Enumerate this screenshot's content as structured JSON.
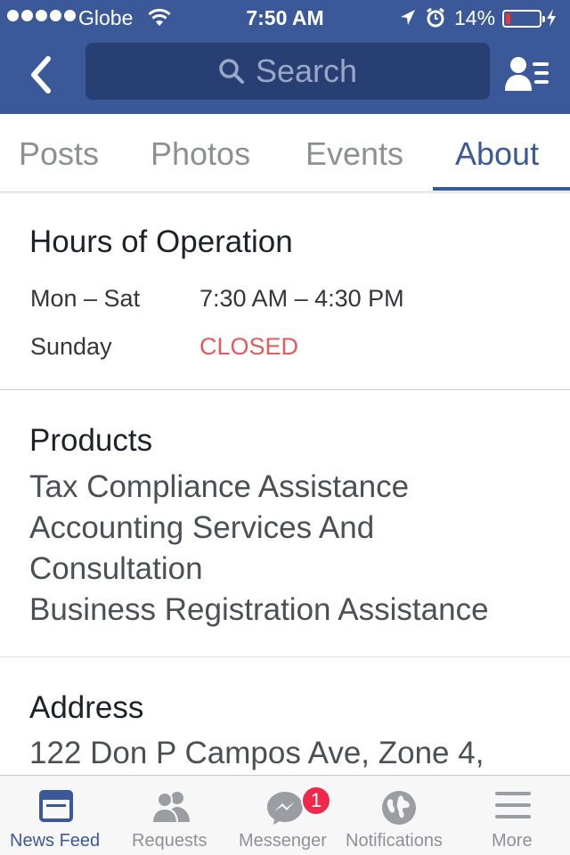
{
  "status_bar": {
    "carrier": "Globe",
    "time": "7:50 AM",
    "battery_percent": "14%",
    "battery_level": 0.14,
    "signal_bars": 5
  },
  "header": {
    "back_icon": "chevron-left-icon",
    "search_placeholder": "Search",
    "friends_icon": "friend-list-icon"
  },
  "tabs": [
    {
      "label": "Posts",
      "active": false
    },
    {
      "label": "Photos",
      "active": false
    },
    {
      "label": "Events",
      "active": false
    },
    {
      "label": "About",
      "active": true
    }
  ],
  "hours": {
    "title": "Hours of Operation",
    "rows": [
      {
        "day": "Mon – Sat",
        "time": "7:30 AM – 4:30 PM"
      },
      {
        "day": "Sunday",
        "time": "CLOSED"
      }
    ]
  },
  "products": {
    "title": "Products",
    "lines": [
      "Tax Compliance Assistance",
      "Accounting Services And",
      "Consultation",
      "Business Registration Assistance"
    ]
  },
  "address": {
    "title": "Address",
    "line": "122 Don P Campos Ave, Zone 4,"
  },
  "bottom_tabs": [
    {
      "label": "News Feed",
      "icon": "news-feed-icon",
      "active": true
    },
    {
      "label": "Requests",
      "icon": "friend-requests-icon",
      "active": false
    },
    {
      "label": "Messenger",
      "icon": "messenger-icon",
      "active": false,
      "badge": "1"
    },
    {
      "label": "Notifications",
      "icon": "globe-icon",
      "active": false
    },
    {
      "label": "More",
      "icon": "menu-icon",
      "active": false
    }
  ],
  "colors": {
    "brand": "#3b5998",
    "closed": "#e05b5b",
    "battery_low": "#e8383a",
    "badge": "#f02849"
  }
}
